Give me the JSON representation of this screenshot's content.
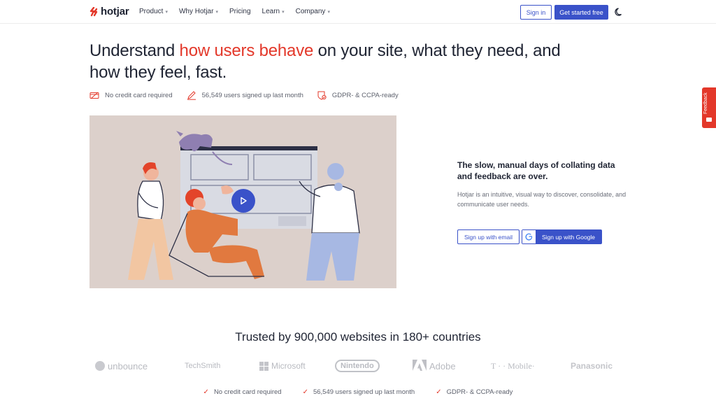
{
  "brand": {
    "name": "hotjar",
    "accent": "#e3382a",
    "primary": "#3a52c9"
  },
  "nav": {
    "items": [
      {
        "label": "Product",
        "dropdown": true
      },
      {
        "label": "Why Hotjar",
        "dropdown": true
      },
      {
        "label": "Pricing",
        "dropdown": false
      },
      {
        "label": "Learn",
        "dropdown": true
      },
      {
        "label": "Company",
        "dropdown": true
      }
    ],
    "signin_label": "Sign in",
    "get_started_label": "Get started free",
    "theme_toggle_icon": "moon-icon"
  },
  "hero": {
    "title_pre": "Understand ",
    "title_accent": "how users behave",
    "title_post": " on your site, what they need, and how they feel, fast.",
    "badges": [
      {
        "icon": "credit-card-icon",
        "label": "No credit card required"
      },
      {
        "icon": "pencil-icon",
        "label": "56,549 users signed up last month"
      },
      {
        "icon": "shield-check-icon",
        "label": "GDPR- & CCPA-ready"
      }
    ]
  },
  "video": {
    "play_icon": "play-icon"
  },
  "side": {
    "title": "The slow, manual days of collating data and feedback are over.",
    "description": "Hotjar is an intuitive, visual way to discover, consolidate, and communicate user needs.",
    "email_button": "Sign up with email",
    "google_button": "Sign up with Google",
    "google_letter": "G"
  },
  "feedback": {
    "label": "Feedback"
  },
  "trusted": {
    "title": "Trusted by 900,000 websites in 180+ countries",
    "logos": [
      "unbounce",
      "TechSmith",
      "Microsoft",
      "Nintendo",
      "Adobe",
      "T · · Mobile·",
      "Panasonic"
    ]
  },
  "footer_badges": [
    "No credit card required",
    "56,549 users signed up last month",
    "GDPR- & CCPA-ready"
  ]
}
